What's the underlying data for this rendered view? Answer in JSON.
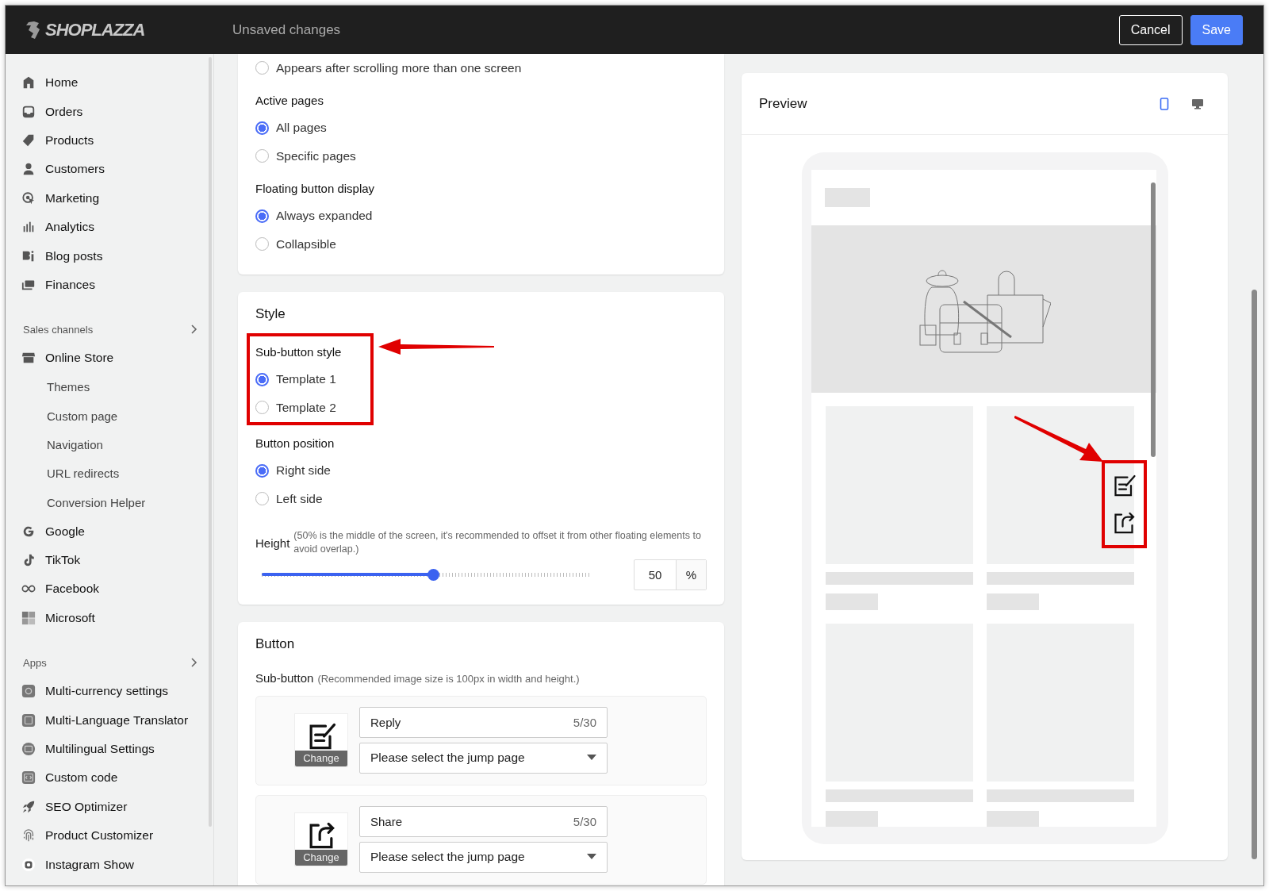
{
  "header": {
    "logo": "SHOPLAZZA",
    "title": "Unsaved changes",
    "buttons": [
      {
        "label": "Cancel",
        "kind": "secondary"
      },
      {
        "label": "Save",
        "kind": "primary"
      }
    ]
  },
  "sidebar": {
    "items": [
      {
        "label": "Home"
      },
      {
        "label": "Orders"
      },
      {
        "label": "Products"
      },
      {
        "label": "Customers"
      },
      {
        "label": "Marketing"
      },
      {
        "label": "Analytics"
      },
      {
        "label": "Blog posts"
      },
      {
        "label": "Finances"
      }
    ],
    "sections": [
      {
        "title": "Sales channels",
        "items": [
          {
            "label": "Online Store",
            "children": [
              {
                "label": "Themes"
              },
              {
                "label": "Custom page"
              },
              {
                "label": "Navigation"
              },
              {
                "label": "URL redirects"
              },
              {
                "label": "Conversion Helper"
              }
            ]
          },
          {
            "label": "Google"
          },
          {
            "label": "TikTok"
          },
          {
            "label": "Facebook"
          },
          {
            "label": "Microsoft"
          }
        ]
      },
      {
        "title": "Apps",
        "items": [
          {
            "label": "Multi-currency settings"
          },
          {
            "label": "Multi-Language Translator"
          },
          {
            "label": "Multilingual Settings"
          },
          {
            "label": "Custom code"
          },
          {
            "label": "SEO Optimizer"
          },
          {
            "label": "Product Customizer"
          },
          {
            "label": "Instagram Show"
          }
        ]
      }
    ]
  },
  "display_card": {
    "groups": [
      {
        "options": [
          {
            "label": "Appears after scrolling more than one screen",
            "selected": false
          }
        ]
      },
      {
        "title": "Active pages",
        "options": [
          {
            "label": "All pages",
            "selected": true
          },
          {
            "label": "Specific pages",
            "selected": false
          }
        ]
      },
      {
        "title": "Floating button display",
        "options": [
          {
            "label": "Always expanded",
            "selected": true
          },
          {
            "label": "Collapsible",
            "selected": false
          }
        ]
      }
    ]
  },
  "style_card": {
    "title": "Style",
    "groups": [
      {
        "title": "Sub-button style",
        "highlighted": true,
        "options": [
          {
            "label": "Template 1",
            "selected": true
          },
          {
            "label": "Template 2",
            "selected": false
          }
        ]
      },
      {
        "title": "Button position",
        "highlighted": false,
        "options": [
          {
            "label": "Right side",
            "selected": true
          },
          {
            "label": "Left side",
            "selected": false
          }
        ]
      }
    ],
    "height": {
      "label": "Height",
      "hint": "(50% is the middle of the screen, it's recommended to offset it from other floating elements to avoid overlap.)",
      "level": 0.5,
      "value": "50",
      "unit": "%"
    }
  },
  "button_card": {
    "title": "Button",
    "sub_button": {
      "label": "Sub-button",
      "hint": "(Recommended image size is 100px in width and height.)"
    },
    "items": [
      {
        "name": "Reply",
        "count": "5/30",
        "change": "Change",
        "jump_placeholder": "Please select the jump page"
      },
      {
        "name": "Share",
        "count": "5/30",
        "change": "Change",
        "jump_placeholder": "Please select the jump page"
      }
    ]
  },
  "preview": {
    "title": "Preview",
    "devices": [
      {
        "selected": true
      },
      {
        "selected": false
      }
    ],
    "highlighted": true
  }
}
